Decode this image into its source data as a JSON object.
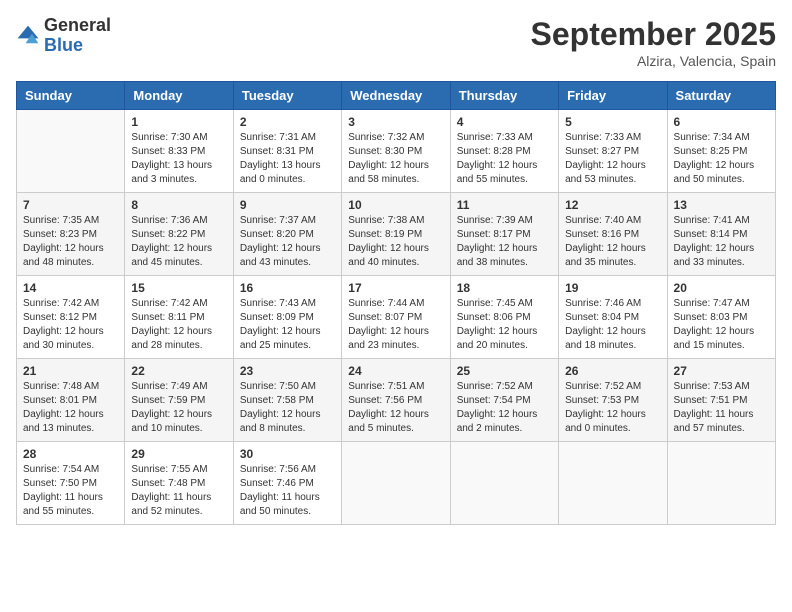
{
  "header": {
    "logo_general": "General",
    "logo_blue": "Blue",
    "month_title": "September 2025",
    "subtitle": "Alzira, Valencia, Spain"
  },
  "weekdays": [
    "Sunday",
    "Monday",
    "Tuesday",
    "Wednesday",
    "Thursday",
    "Friday",
    "Saturday"
  ],
  "weeks": [
    [
      {
        "day": "",
        "info": ""
      },
      {
        "day": "1",
        "info": "Sunrise: 7:30 AM\nSunset: 8:33 PM\nDaylight: 13 hours\nand 3 minutes."
      },
      {
        "day": "2",
        "info": "Sunrise: 7:31 AM\nSunset: 8:31 PM\nDaylight: 13 hours\nand 0 minutes."
      },
      {
        "day": "3",
        "info": "Sunrise: 7:32 AM\nSunset: 8:30 PM\nDaylight: 12 hours\nand 58 minutes."
      },
      {
        "day": "4",
        "info": "Sunrise: 7:33 AM\nSunset: 8:28 PM\nDaylight: 12 hours\nand 55 minutes."
      },
      {
        "day": "5",
        "info": "Sunrise: 7:33 AM\nSunset: 8:27 PM\nDaylight: 12 hours\nand 53 minutes."
      },
      {
        "day": "6",
        "info": "Sunrise: 7:34 AM\nSunset: 8:25 PM\nDaylight: 12 hours\nand 50 minutes."
      }
    ],
    [
      {
        "day": "7",
        "info": "Sunrise: 7:35 AM\nSunset: 8:23 PM\nDaylight: 12 hours\nand 48 minutes."
      },
      {
        "day": "8",
        "info": "Sunrise: 7:36 AM\nSunset: 8:22 PM\nDaylight: 12 hours\nand 45 minutes."
      },
      {
        "day": "9",
        "info": "Sunrise: 7:37 AM\nSunset: 8:20 PM\nDaylight: 12 hours\nand 43 minutes."
      },
      {
        "day": "10",
        "info": "Sunrise: 7:38 AM\nSunset: 8:19 PM\nDaylight: 12 hours\nand 40 minutes."
      },
      {
        "day": "11",
        "info": "Sunrise: 7:39 AM\nSunset: 8:17 PM\nDaylight: 12 hours\nand 38 minutes."
      },
      {
        "day": "12",
        "info": "Sunrise: 7:40 AM\nSunset: 8:16 PM\nDaylight: 12 hours\nand 35 minutes."
      },
      {
        "day": "13",
        "info": "Sunrise: 7:41 AM\nSunset: 8:14 PM\nDaylight: 12 hours\nand 33 minutes."
      }
    ],
    [
      {
        "day": "14",
        "info": "Sunrise: 7:42 AM\nSunset: 8:12 PM\nDaylight: 12 hours\nand 30 minutes."
      },
      {
        "day": "15",
        "info": "Sunrise: 7:42 AM\nSunset: 8:11 PM\nDaylight: 12 hours\nand 28 minutes."
      },
      {
        "day": "16",
        "info": "Sunrise: 7:43 AM\nSunset: 8:09 PM\nDaylight: 12 hours\nand 25 minutes."
      },
      {
        "day": "17",
        "info": "Sunrise: 7:44 AM\nSunset: 8:07 PM\nDaylight: 12 hours\nand 23 minutes."
      },
      {
        "day": "18",
        "info": "Sunrise: 7:45 AM\nSunset: 8:06 PM\nDaylight: 12 hours\nand 20 minutes."
      },
      {
        "day": "19",
        "info": "Sunrise: 7:46 AM\nSunset: 8:04 PM\nDaylight: 12 hours\nand 18 minutes."
      },
      {
        "day": "20",
        "info": "Sunrise: 7:47 AM\nSunset: 8:03 PM\nDaylight: 12 hours\nand 15 minutes."
      }
    ],
    [
      {
        "day": "21",
        "info": "Sunrise: 7:48 AM\nSunset: 8:01 PM\nDaylight: 12 hours\nand 13 minutes."
      },
      {
        "day": "22",
        "info": "Sunrise: 7:49 AM\nSunset: 7:59 PM\nDaylight: 12 hours\nand 10 minutes."
      },
      {
        "day": "23",
        "info": "Sunrise: 7:50 AM\nSunset: 7:58 PM\nDaylight: 12 hours\nand 8 minutes."
      },
      {
        "day": "24",
        "info": "Sunrise: 7:51 AM\nSunset: 7:56 PM\nDaylight: 12 hours\nand 5 minutes."
      },
      {
        "day": "25",
        "info": "Sunrise: 7:52 AM\nSunset: 7:54 PM\nDaylight: 12 hours\nand 2 minutes."
      },
      {
        "day": "26",
        "info": "Sunrise: 7:52 AM\nSunset: 7:53 PM\nDaylight: 12 hours\nand 0 minutes."
      },
      {
        "day": "27",
        "info": "Sunrise: 7:53 AM\nSunset: 7:51 PM\nDaylight: 11 hours\nand 57 minutes."
      }
    ],
    [
      {
        "day": "28",
        "info": "Sunrise: 7:54 AM\nSunset: 7:50 PM\nDaylight: 11 hours\nand 55 minutes."
      },
      {
        "day": "29",
        "info": "Sunrise: 7:55 AM\nSunset: 7:48 PM\nDaylight: 11 hours\nand 52 minutes."
      },
      {
        "day": "30",
        "info": "Sunrise: 7:56 AM\nSunset: 7:46 PM\nDaylight: 11 hours\nand 50 minutes."
      },
      {
        "day": "",
        "info": ""
      },
      {
        "day": "",
        "info": ""
      },
      {
        "day": "",
        "info": ""
      },
      {
        "day": "",
        "info": ""
      }
    ]
  ]
}
